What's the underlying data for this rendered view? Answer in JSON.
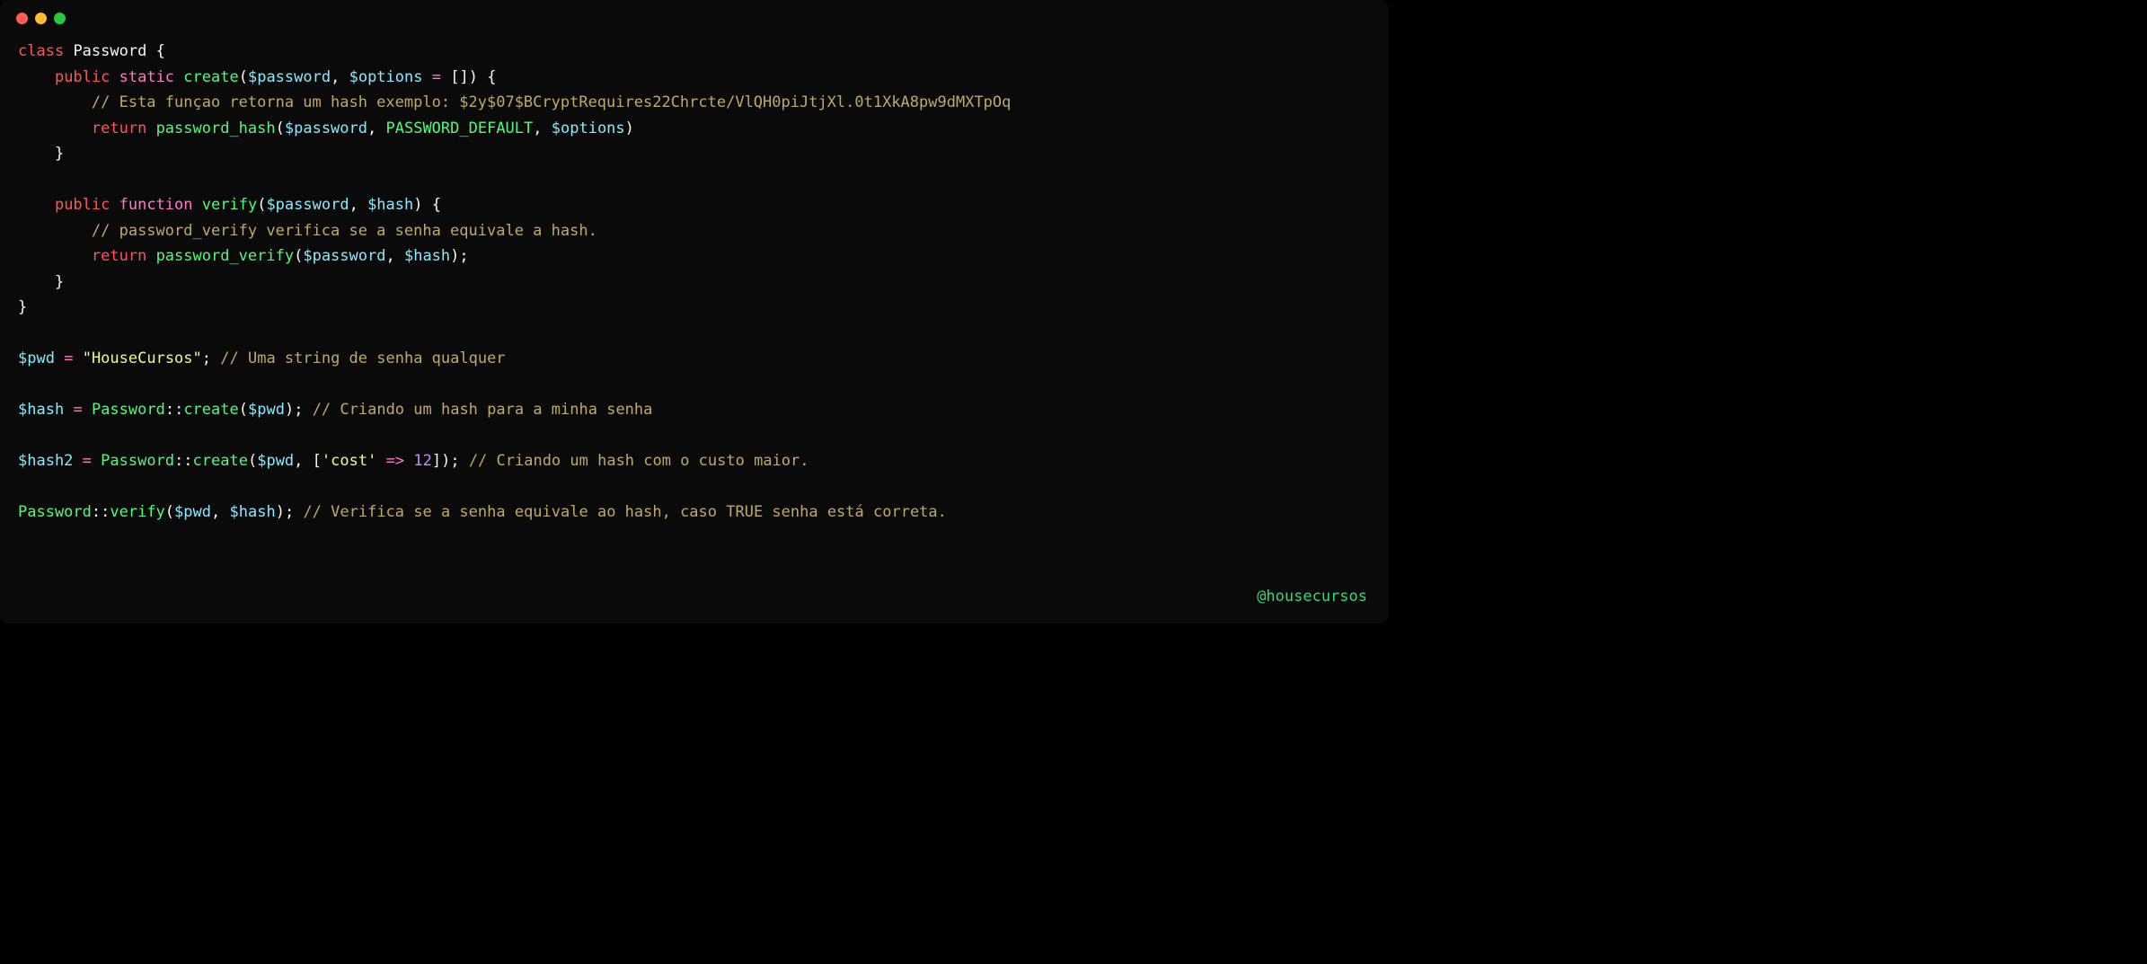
{
  "tokens": {
    "kw_class": "class",
    "kw_public": "public",
    "kw_static": "static",
    "kw_function": "function",
    "kw_return": "return",
    "cls_Password": "Password",
    "fn_create": "create",
    "fn_verify": "verify",
    "fn_password_hash": "password_hash",
    "fn_password_verify": "password_verify",
    "var_password": "$password",
    "var_options": "$options",
    "var_hash": "$hash",
    "var_pwd": "$pwd",
    "var_hash2": "$hash2",
    "const_PASSWORD_DEFAULT": "PASSWORD_DEFAULT",
    "str_HouseCursos": "\"HouseCursos\"",
    "str_cost": "'cost'",
    "num_12": "12",
    "op_arrow": "=>",
    "op_scope": "::",
    "eq": "="
  },
  "comments": {
    "c1": "// Esta funçao retorna um hash exemplo: $2y$07$BCryptRequires22Chrcte/VlQH0piJtjXl.0t1XkA8pw9dMXTpOq",
    "c2": "// password_verify verifica se a senha equivale a hash.",
    "c3": "// Uma string de senha qualquer",
    "c4": "// Criando um hash para a minha senha",
    "c5": "// Criando um hash com o custo maior.",
    "c6": "// Verifica se a senha equivale ao hash, caso TRUE senha está correta."
  },
  "watermark": "@housecursos"
}
